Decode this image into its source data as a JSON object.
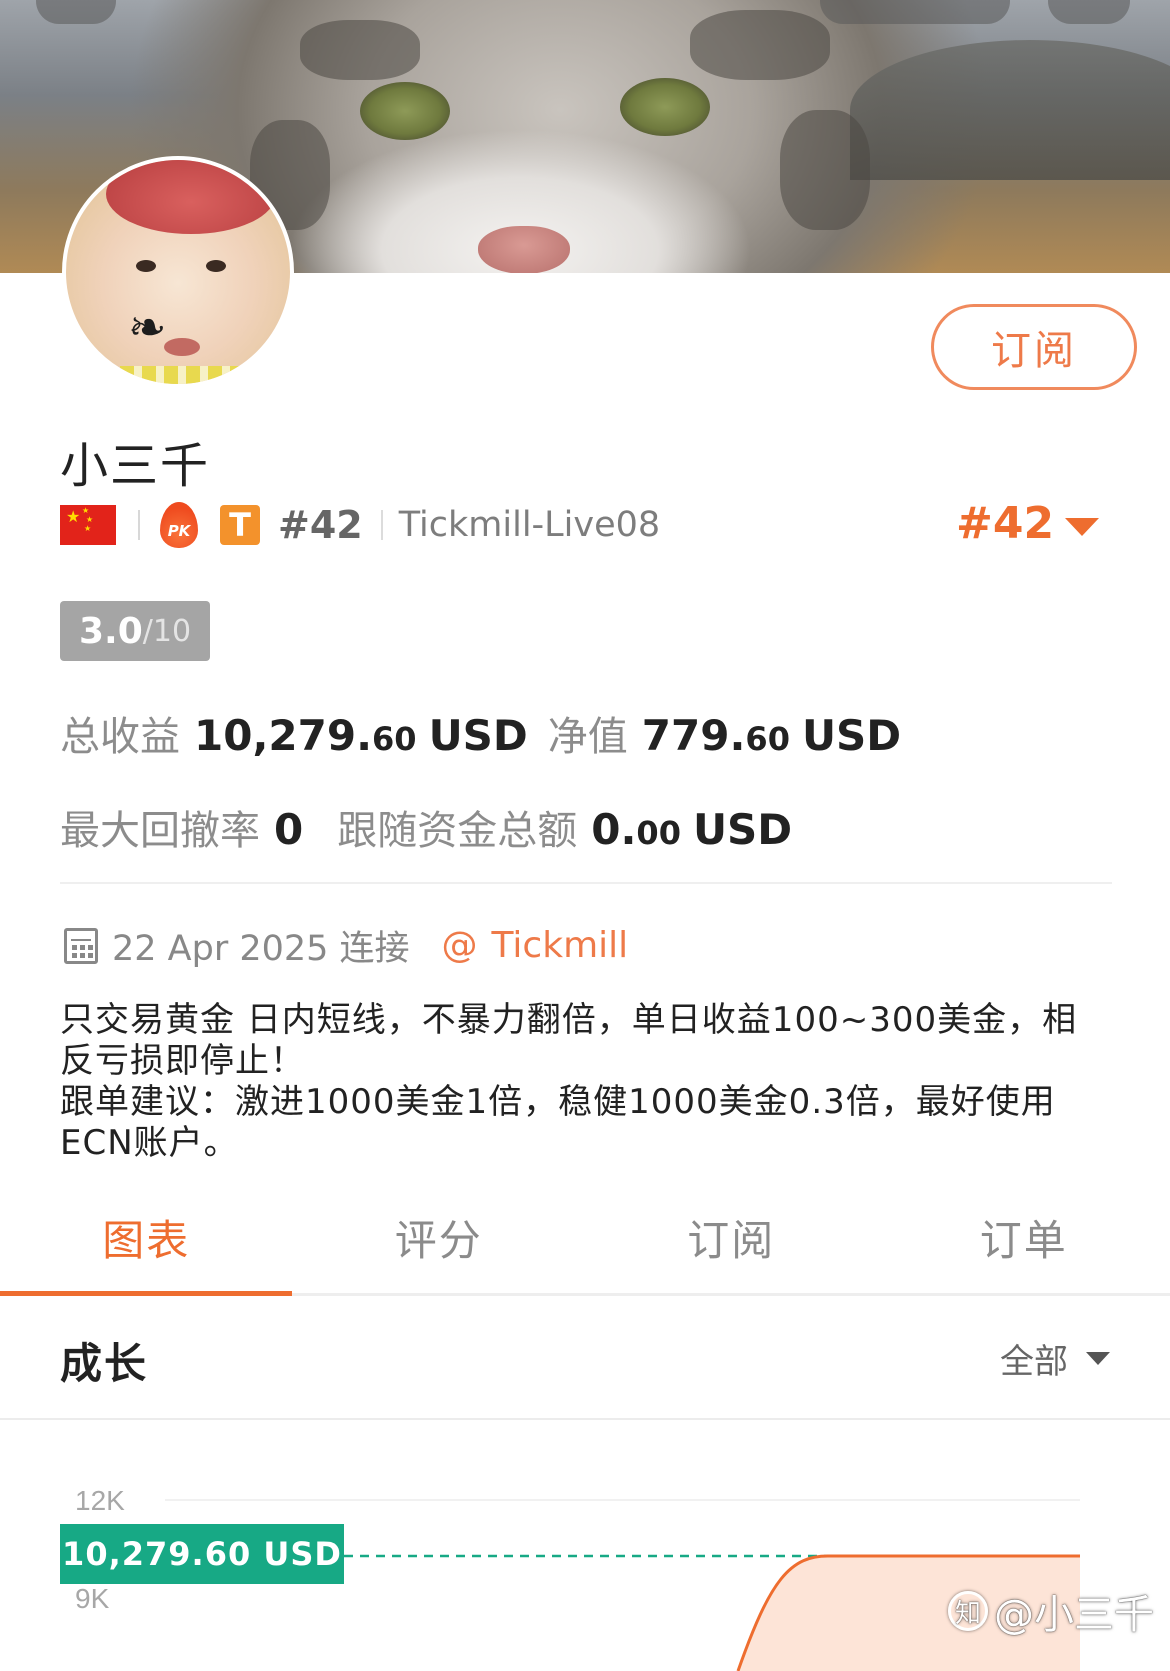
{
  "profile": {
    "subscribe_label": "订阅",
    "name": "小三千",
    "pk_label": "PK",
    "t_badge": "T",
    "rank_small": "#42",
    "server": "Tickmill-Live08",
    "rank_big": "#42",
    "score": "3.0",
    "score_max": "/10"
  },
  "stats": {
    "total_profit_label": "总收益",
    "total_profit_int": "10,279.",
    "total_profit_dec": "60",
    "total_profit_unit": "USD",
    "equity_label": "净值",
    "equity_int": "779.",
    "equity_dec": "60",
    "equity_unit": "USD",
    "max_drawdown_label": "最大回撤率",
    "max_drawdown_value": "0",
    "follow_total_label": "跟随资金总额",
    "follow_total_int": "0.",
    "follow_total_dec": "00",
    "follow_total_unit": "USD"
  },
  "joined": {
    "date_text": "22 Apr 2025 连接",
    "at_symbol": "@",
    "broker": "Tickmill"
  },
  "description": {
    "line1": "只交易黄金 日内短线，不暴力翻倍，单日收益100~300美金，相",
    "line2": "反亏损即停止！",
    "line3": "跟单建议：激进1000美金1倍，稳健1000美金0.3倍，最好使用",
    "line4": "ECN账户。"
  },
  "tabs": [
    {
      "label": "图表",
      "active": true
    },
    {
      "label": "评分",
      "active": false
    },
    {
      "label": "订阅",
      "active": false
    },
    {
      "label": "订单",
      "active": false
    }
  ],
  "growth": {
    "title": "成长",
    "filter_label": "全部"
  },
  "chart_data": {
    "type": "area",
    "y_ticks": [
      "12K",
      "9K"
    ],
    "current_value_label": "10,279.60 USD",
    "current_value": 10279.6,
    "ylim_visible": [
      9000,
      12000
    ],
    "colors": {
      "line": "#ee6d2f",
      "fill": "#fde4d7",
      "reference": "#17a985"
    }
  },
  "watermark": {
    "logo": "知",
    "text": "@小三千"
  },
  "colors": {
    "accent": "#ee6d2f",
    "green": "#17a985"
  }
}
